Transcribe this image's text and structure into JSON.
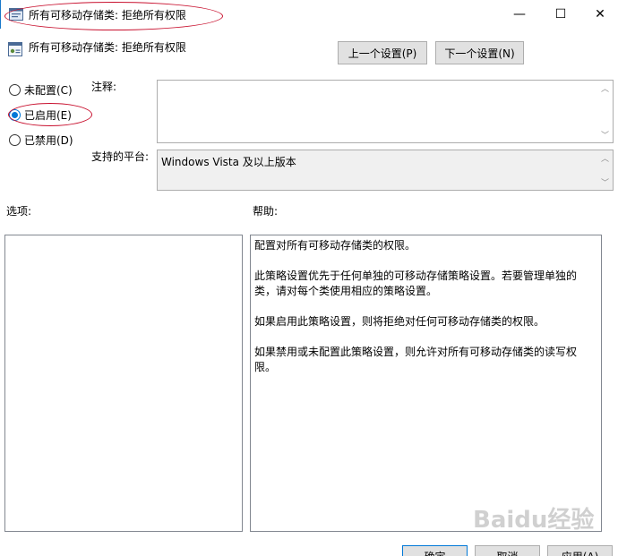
{
  "window": {
    "title": "所有可移动存储类: 拒绝所有权限",
    "controls": {
      "minimize": "—",
      "maximize": "☐",
      "close": "✕"
    }
  },
  "header": {
    "policy_name": "所有可移动存储类: 拒绝所有权限",
    "prev_label": "上一个设置(P)",
    "next_label": "下一个设置(N)"
  },
  "state": {
    "options": [
      {
        "label": "未配置(C)",
        "checked": false
      },
      {
        "label": "已启用(E)",
        "checked": true
      },
      {
        "label": "已禁用(D)",
        "checked": false
      }
    ]
  },
  "comment": {
    "label": "注释:",
    "value": ""
  },
  "platform": {
    "label": "支持的平台:",
    "value": "Windows Vista 及以上版本"
  },
  "options_panel": {
    "label": "选项:"
  },
  "help_panel": {
    "label": "帮助:",
    "paragraphs": [
      "配置对所有可移动存储类的权限。",
      "此策略设置优先于任何单独的可移动存储策略设置。若要管理单独的类，请对每个类使用相应的策略设置。",
      "如果启用此策略设置，则将拒绝对任何可移动存储类的权限。",
      "如果禁用或未配置此策略设置，则允许对所有可移动存储类的读写权限。"
    ]
  },
  "footer": {
    "ok_label": "确定",
    "cancel_label": "取消",
    "apply_label": "应用(A)"
  },
  "watermark": "Baidu经验",
  "colors": {
    "accent": "#0078d7",
    "annotation": "#c8102e",
    "button_bg": "#e1e1e1"
  }
}
